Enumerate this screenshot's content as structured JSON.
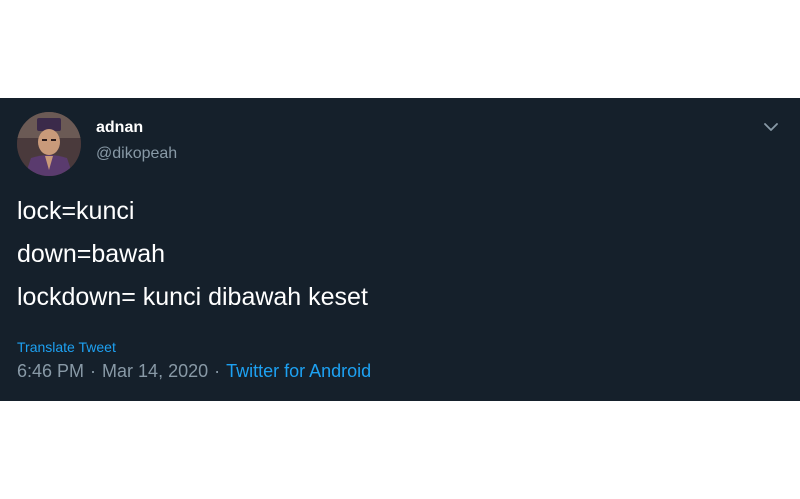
{
  "tweet": {
    "user": {
      "name": "adnan",
      "handle": "@dikopeah"
    },
    "body_lines": [
      "lock=kunci",
      "down=bawah",
      "lockdown= kunci dibawah keset"
    ],
    "translate_label": "Translate Tweet",
    "time": "6:46 PM",
    "date": "Mar 14, 2020",
    "separator": "·",
    "source": "Twitter for Android",
    "menu_icon": "chevron-down-icon"
  },
  "colors": {
    "card_background": "#15202b",
    "primary_text": "#ffffff",
    "secondary_text": "#8899a6",
    "link": "#1da1f2"
  }
}
